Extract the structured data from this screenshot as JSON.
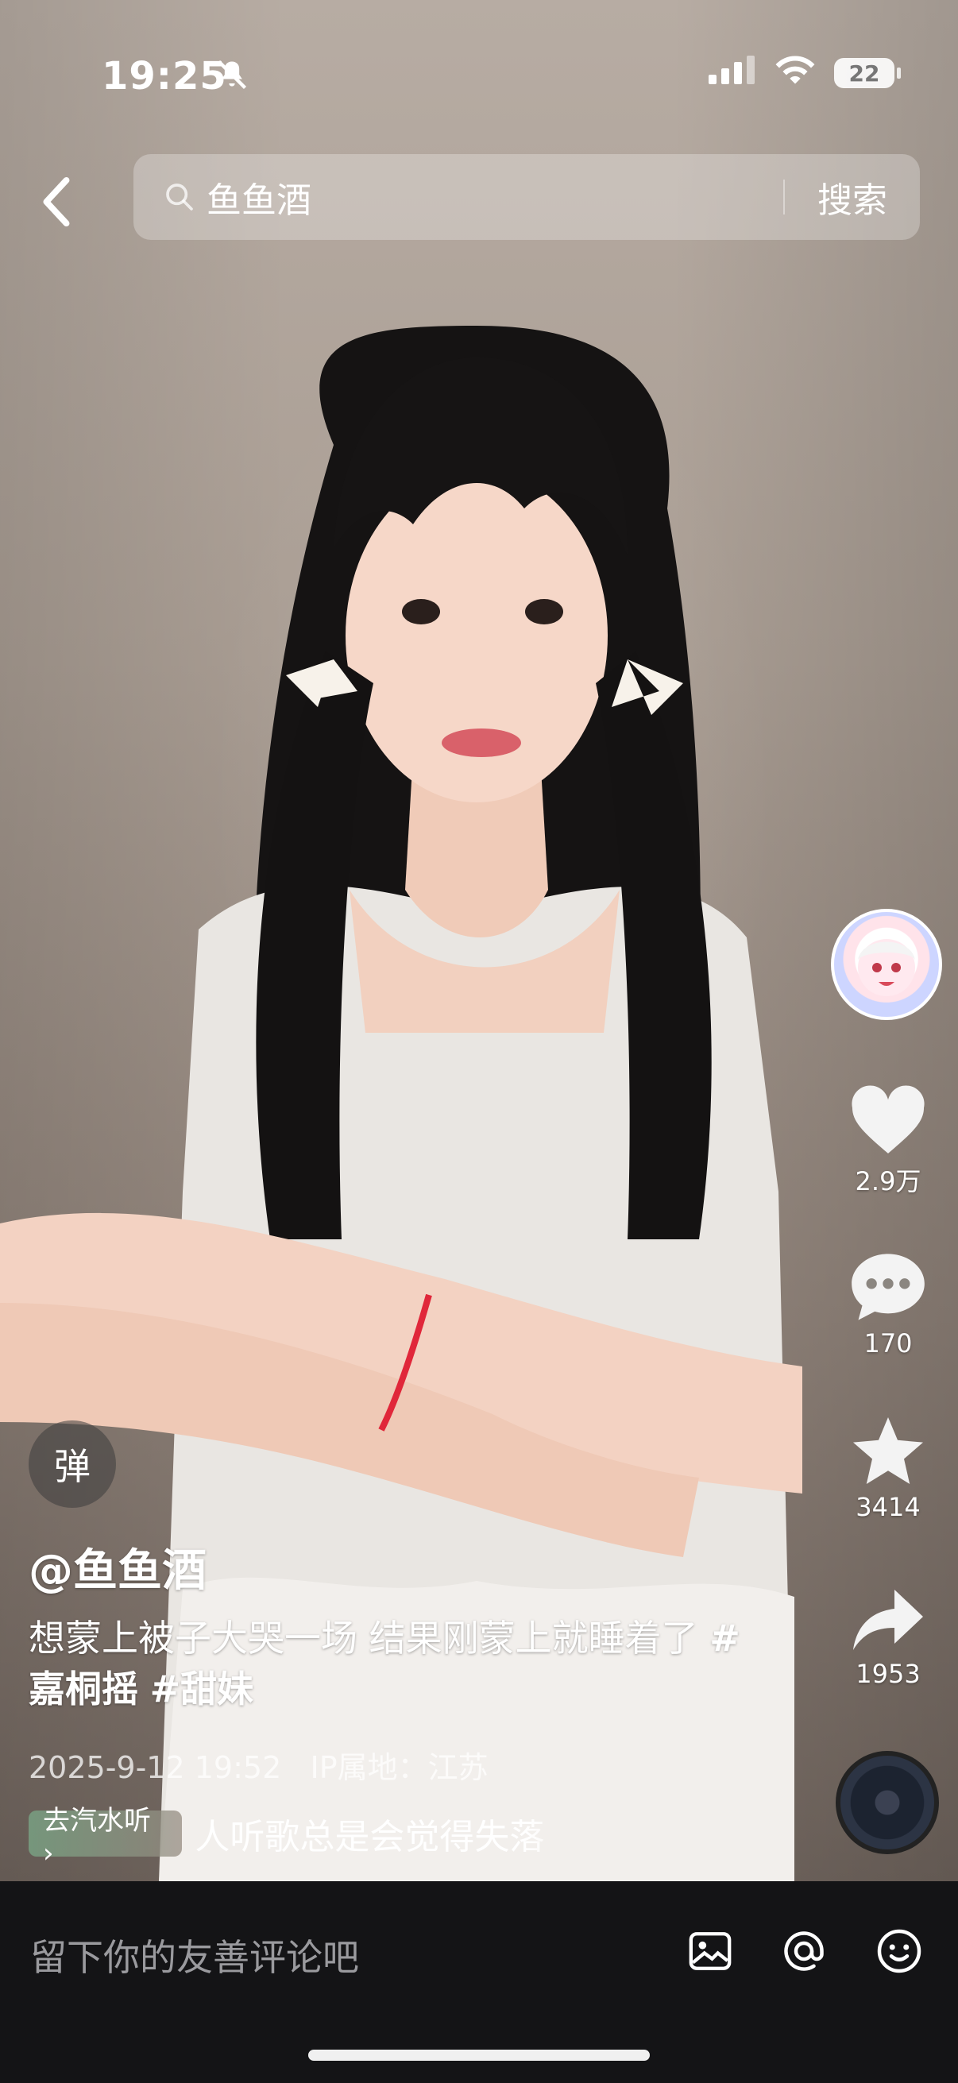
{
  "status_bar": {
    "time": "19:25",
    "battery": "22"
  },
  "search": {
    "query": "鱼鱼酒",
    "button": "搜索"
  },
  "actions": {
    "like_count": "2.9万",
    "comment_count": "170",
    "favorite_count": "3414",
    "share_count": "1953"
  },
  "overlay": {
    "danmu_label": "弹",
    "author": "@鱼鱼酒",
    "description": "想蒙上被子大哭一场 结果刚蒙上就睡着了",
    "tags": [
      "#嘉桐摇",
      "#甜妹"
    ],
    "date": "2025-9-12 19:52",
    "ip": "IP属地：江苏",
    "music_chip": "去汽水听 ›",
    "music_title": "人听歌总是会觉得失落"
  },
  "comment_bar": {
    "placeholder": "留下你的友善评论吧"
  },
  "icons": [
    "back-icon",
    "search-icon",
    "heart-icon",
    "comment-icon",
    "star-icon",
    "share-icon",
    "image-icon",
    "at-icon",
    "emoji-icon",
    "mute-icon",
    "signal-icon",
    "wifi-icon"
  ]
}
